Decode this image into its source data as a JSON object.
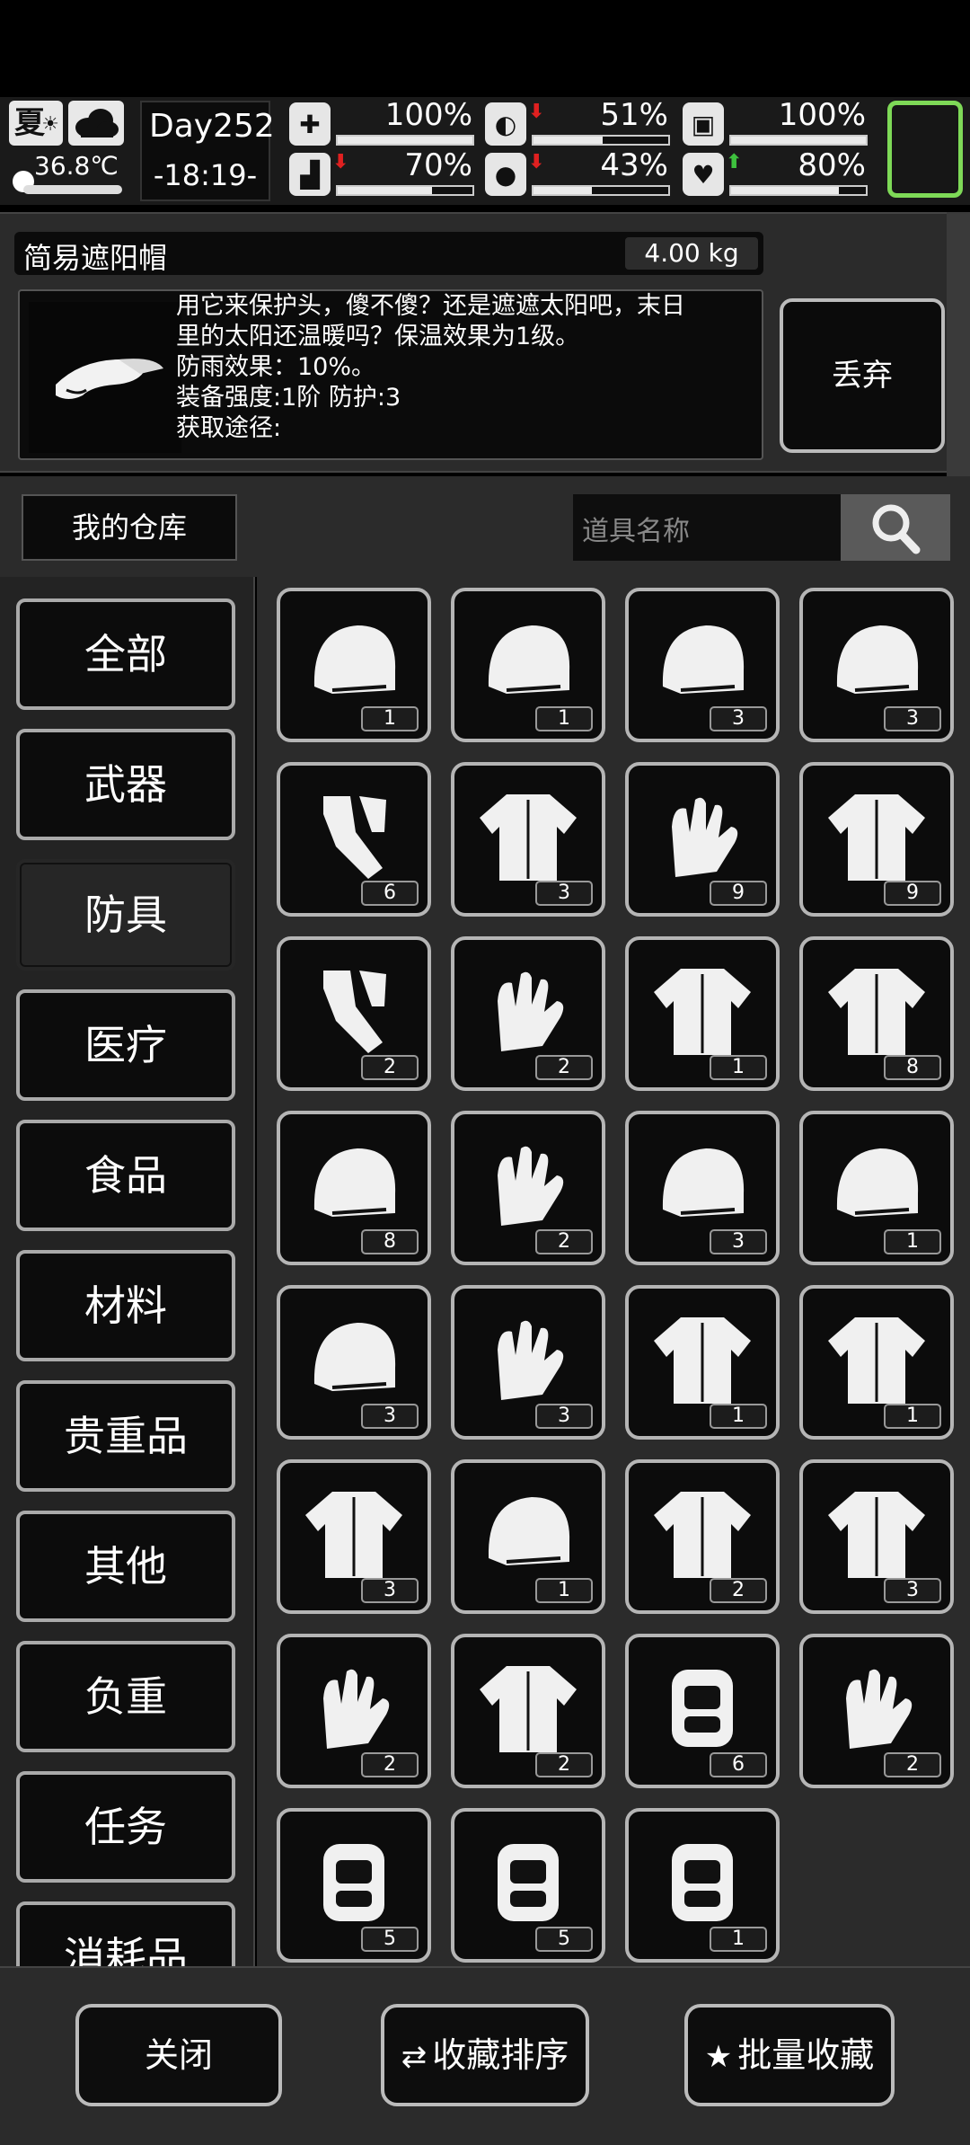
{
  "status": {
    "season": "夏",
    "temperature": "36.8℃",
    "day": "Day252",
    "time": "-18:19-",
    "stats": [
      {
        "icon": "medkit-icon",
        "glyph": "✚",
        "value": "100%",
        "fraction": 1.0,
        "trend": ""
      },
      {
        "icon": "stomach-icon",
        "glyph": "◐",
        "value": "51%",
        "fraction": 0.51,
        "trend": "down"
      },
      {
        "icon": "pill-icon",
        "glyph": "▣",
        "value": "100%",
        "fraction": 1.0,
        "trend": ""
      },
      {
        "icon": "boot-icon",
        "glyph": "▟",
        "value": "70%",
        "fraction": 0.7,
        "trend": "down"
      },
      {
        "icon": "water-drop-icon",
        "glyph": "●",
        "value": "43%",
        "fraction": 0.43,
        "trend": "down"
      },
      {
        "icon": "heart-icon",
        "glyph": "♥",
        "value": "80%",
        "fraction": 0.8,
        "trend": "up"
      }
    ],
    "colors": {
      "trend_down": "#e02020",
      "trend_up": "#3ec13e",
      "slot_border": "#7ed957"
    }
  },
  "detail": {
    "name": "简易遮阳帽",
    "weight": "4.00 kg",
    "lines": [
      "用它来保护头，傻不傻？还是遮遮太阳吧，末日",
      "里的太阳还温暖吗？保温效果为1级。",
      "防雨效果：10%。",
      "装备强度:1阶  防护:3",
      "获取途径:"
    ],
    "discard_label": "丢弃"
  },
  "storage": {
    "title": "我的仓库",
    "search_placeholder": "道具名称"
  },
  "categories": [
    {
      "label": "全部",
      "selected": false
    },
    {
      "label": "武器",
      "selected": false
    },
    {
      "label": "防具",
      "selected": true
    },
    {
      "label": "医疗",
      "selected": false
    },
    {
      "label": "食品",
      "selected": false
    },
    {
      "label": "材料",
      "selected": false
    },
    {
      "label": "贵重品",
      "selected": false
    },
    {
      "label": "其他",
      "selected": false
    },
    {
      "label": "负重",
      "selected": false
    },
    {
      "label": "任务",
      "selected": false
    },
    {
      "label": "消耗品",
      "selected": false
    }
  ],
  "items": [
    {
      "icon": "motorcycle-helmet-icon",
      "count": "1"
    },
    {
      "icon": "army-helmet-icon",
      "count": "1"
    },
    {
      "icon": "tactical-helmet-icon",
      "count": "3"
    },
    {
      "icon": "skull-helmet-icon",
      "count": "3"
    },
    {
      "icon": "leg-wraps-icon",
      "count": "6"
    },
    {
      "icon": "t-shirt-icon",
      "count": "3"
    },
    {
      "icon": "work-gloves-icon",
      "count": "9"
    },
    {
      "icon": "hoodie-icon",
      "count": "9"
    },
    {
      "icon": "socks-icon",
      "count": "2"
    },
    {
      "icon": "fingerless-gloves-icon",
      "count": "2"
    },
    {
      "icon": "tracksuit-icon",
      "count": "1"
    },
    {
      "icon": "jacket-icon",
      "count": "8"
    },
    {
      "icon": "bucket-hat-icon",
      "count": "8"
    },
    {
      "icon": "long-glove-icon",
      "count": "2"
    },
    {
      "icon": "aviator-cap-icon",
      "count": "3"
    },
    {
      "icon": "fur-hat-icon",
      "count": "1"
    },
    {
      "icon": "fur-trim-hat-icon",
      "count": "3"
    },
    {
      "icon": "knit-mittens-icon",
      "count": "3"
    },
    {
      "icon": "raccoon-suit-icon",
      "count": "1"
    },
    {
      "icon": "bunny-coat-icon",
      "count": "1"
    },
    {
      "icon": "cloak-icon",
      "count": "3"
    },
    {
      "icon": "straw-cape-icon",
      "count": "1"
    },
    {
      "icon": "tactical-vest-icon",
      "count": "2"
    },
    {
      "icon": "fur-coat-icon",
      "count": "3"
    },
    {
      "icon": "biker-gloves-icon",
      "count": "2"
    },
    {
      "icon": "fur-vest-icon",
      "count": "2"
    },
    {
      "icon": "knee-pads-icon",
      "count": "6"
    },
    {
      "icon": "leather-gloves-icon",
      "count": "2"
    },
    {
      "icon": "body-armor-icon",
      "count": "5"
    },
    {
      "icon": "shin-guards-icon",
      "count": "5"
    },
    {
      "icon": "chest-armor-icon",
      "count": "1"
    }
  ],
  "bottom": {
    "close_label": "关闭",
    "sort_label": "收藏排序",
    "batch_label": "批量收藏"
  }
}
